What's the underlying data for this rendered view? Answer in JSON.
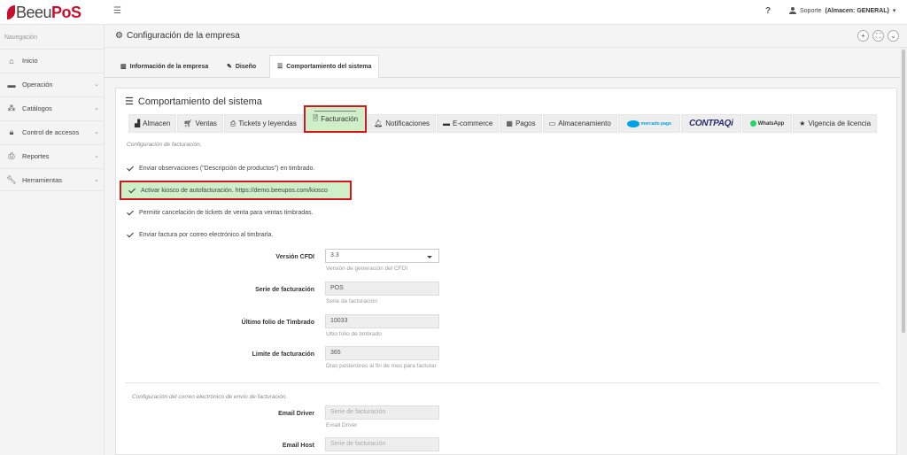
{
  "app": {
    "logo_plain": "Beeu",
    "logo_bold": "PoS",
    "help": "?",
    "user": "Soporte",
    "store": "(Almacen: GENERAL)"
  },
  "sidebar": {
    "nav_label": "Navegación",
    "items": [
      {
        "label": "Inicio",
        "icon": "home-icon"
      },
      {
        "label": "Operación",
        "icon": "briefcase-icon"
      },
      {
        "label": "Catálogos",
        "icon": "cubes-icon"
      },
      {
        "label": "Control de accesos",
        "icon": "lock-icon"
      },
      {
        "label": "Reportes",
        "icon": "print-icon"
      },
      {
        "label": "Herramientas",
        "icon": "wrench-icon"
      }
    ]
  },
  "header": {
    "title": "Configuración de la empresa"
  },
  "main_tabs": [
    {
      "label": "Información de la empresa",
      "icon": "building-icon"
    },
    {
      "label": "Diseño",
      "icon": "pencil-icon"
    },
    {
      "label": "Comportamiento del sistema",
      "icon": "sliders-icon"
    }
  ],
  "panel": {
    "title": "Comportamiento del sistema",
    "sub_tabs": [
      {
        "label": "Almacen",
        "icon": "industry-icon"
      },
      {
        "label": "Ventas",
        "icon": "cart-icon"
      },
      {
        "label": "Tickets y leyendas",
        "icon": "print-icon"
      },
      {
        "label": "Facturación",
        "icon": "file-icon"
      },
      {
        "label": "Notificaciones",
        "icon": "bell-icon"
      },
      {
        "label": "E-commerce",
        "icon": "card-icon"
      },
      {
        "label": "Pagos",
        "icon": "money-icon"
      },
      {
        "label": "Almacenamiento",
        "icon": "hdd-icon"
      },
      {
        "label": "mercado pago",
        "icon": "mercadopago-logo"
      },
      {
        "label": "CONTPAQi",
        "icon": "contpaqi-logo"
      },
      {
        "label": "WhatsApp",
        "icon": "whatsapp-logo"
      },
      {
        "label": "Vigencia de licencia",
        "icon": "star-icon"
      }
    ],
    "section_note": "Configuración de facturación.",
    "checks": [
      "Enviar observaciones (\"Descripción de productos\") en timbrado.",
      "Activar kiosco de autofacturación. https://demo.beeupos.com/kiosco",
      "Permitir cancelación de tickets de venta para ventas timbradas.",
      "Enviar factura por correo electrónico al timbrarla."
    ],
    "fields": [
      {
        "label": "Versión CFDI",
        "value": "3.3",
        "help": "Versión de generación del CFDI"
      },
      {
        "label": "Serie de facturación",
        "value": "POS",
        "help": "Serie de facturación"
      },
      {
        "label": "Último folio de Timbrado",
        "value": "10033",
        "help": "Ultio folio de timbrado"
      },
      {
        "label": "Limite de facturación",
        "value": "365",
        "help": "Días posteriores al fin de mes para facturar"
      }
    ],
    "email_note": "Configuración del correo electrónico de envío de facturación.",
    "email_fields": [
      {
        "label": "Email Driver",
        "placeholder": "Serie de facturación",
        "help": "Email Driver"
      },
      {
        "label": "Email Host",
        "placeholder": "Serie de facturación",
        "help": ""
      }
    ]
  },
  "colors": {
    "brand": "#c8102e",
    "highlight_bg": "#cfefc9",
    "highlight_border": "#d3171a"
  }
}
